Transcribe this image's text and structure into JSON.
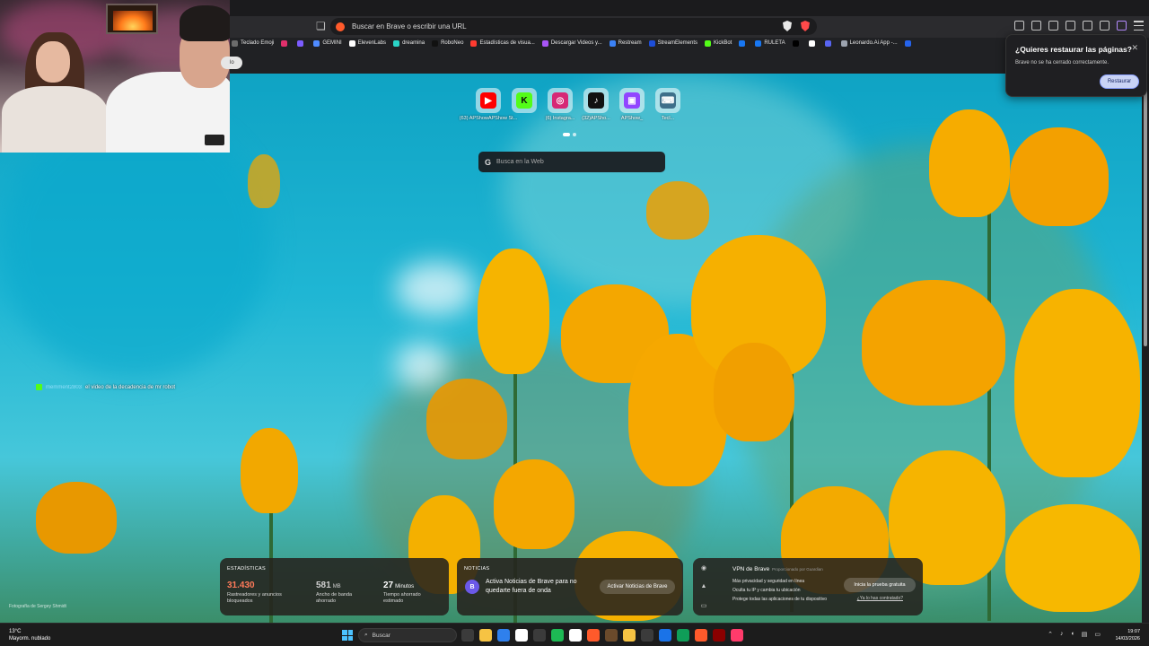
{
  "browser": {
    "omnibox_placeholder": "Buscar en Brave o escribir una URL",
    "bookmarks": [
      {
        "label": "Teclado Emoji",
        "color": "#6b6b6b"
      },
      {
        "label": "",
        "color": "#e1306c"
      },
      {
        "label": "",
        "color": "#7c5cff"
      },
      {
        "label": "GEMINI",
        "color": "#4f8bff"
      },
      {
        "label": "ElevenLabs",
        "color": "#ffffff"
      },
      {
        "label": "dreamina",
        "color": "#2ad4c7"
      },
      {
        "label": "RoboNeo",
        "color": "#111111"
      },
      {
        "label": "Estadísticas de visua...",
        "color": "#ff3b30"
      },
      {
        "label": "Descargar Videos y...",
        "color": "#a855f7"
      },
      {
        "label": "Restream",
        "color": "#3b82f6"
      },
      {
        "label": "StreamElements",
        "color": "#1d4ed8"
      },
      {
        "label": "KickBot",
        "color": "#53fc18"
      },
      {
        "label": "",
        "color": "#1877f2"
      },
      {
        "label": "RULETA",
        "color": "#1877f2"
      },
      {
        "label": "",
        "color": "#000000"
      },
      {
        "label": "",
        "color": "#ffffff"
      },
      {
        "label": "",
        "color": "#5865f2"
      },
      {
        "label": "Leonardo.Ai App -...",
        "color": "#9ca3af"
      },
      {
        "label": "",
        "color": "#2563eb"
      }
    ]
  },
  "restore_dialog": {
    "title": "¿Quieres restaurar las páginas?",
    "message": "Brave no se ha cerrado correctamente.",
    "button": "Restaurar",
    "close": "✕"
  },
  "webcam": {
    "partial_button": "lo"
  },
  "top_sites": [
    {
      "label": "(63) APShowAPShow St...",
      "icon": "youtube-icon",
      "color": "#ff0000",
      "glyph": "▶"
    },
    {
      "label": "",
      "icon": "kick-icon",
      "color": "#53fc18",
      "glyph": "K"
    },
    {
      "label": "(6) Instagra...",
      "icon": "instagram-icon",
      "color": "#d62976",
      "glyph": "◎"
    },
    {
      "label": "(32)APSho...",
      "icon": "tiktok-icon",
      "color": "#111111",
      "glyph": "♪"
    },
    {
      "label": "APShow_",
      "icon": "twitch-icon",
      "color": "#9146ff",
      "glyph": "▣"
    },
    {
      "label": "Tecl...",
      "icon": "keyboard-icon",
      "color": "#3e6f8a",
      "glyph": "⌨"
    }
  ],
  "search": {
    "placeholder": "Busca en la Web",
    "g": "G"
  },
  "chat": {
    "username": "memment2803",
    "message": "el video de la decadencia de mr robot"
  },
  "photo_credit": "Fotografía de Sergey Shmidt",
  "stats_widget": {
    "title": "ESTADÍSTICAS",
    "items": [
      {
        "value": "31.430",
        "unit": "",
        "label1": "Rastreadores y anuncios",
        "label2": "bloqueados",
        "color": "#ff7a5a"
      },
      {
        "value": "581",
        "unit": "MB",
        "label1": "Ancho de banda",
        "label2": "ahorrado",
        "color": "#cfcfcf"
      },
      {
        "value": "27",
        "unit": "Minutos",
        "label1": "Tiempo ahorrado",
        "label2": "estimado",
        "color": "#ffffff"
      }
    ]
  },
  "news_widget": {
    "title": "NOTICIAS",
    "text": "Activa Noticias de Brave para no quedarte fuera de onda",
    "button": "Activar Noticias de Brave"
  },
  "vpn_widget": {
    "title": "VPN de Brave",
    "provider": "Proporcionado por Guardian",
    "features": [
      "Más privacidad y seguridad en línea",
      "Oculta tu IP y cambia tu ubicación",
      "Protege todas las aplicaciones de tu dispositivo"
    ],
    "button": "Inicia la prueba gratuita",
    "link": "¿Ya lo has contratado?"
  },
  "taskbar": {
    "weather_temp": "13°C",
    "weather_desc": "Mayorm. nublado",
    "search_placeholder": "Buscar",
    "time": "19:07",
    "date": "14/03/2026",
    "apps": [
      "#3b3b3b",
      "#f6c343",
      "#2f80ed",
      "#ffffff",
      "#3b3b3b",
      "#1db954",
      "#ffffff",
      "#ff5a2b",
      "#6b4a2b",
      "#f6c343",
      "#3b3b3b",
      "#1a73e8",
      "#0f9d58",
      "#ff5a2b",
      "#8b0000",
      "#ff3b6b"
    ]
  }
}
